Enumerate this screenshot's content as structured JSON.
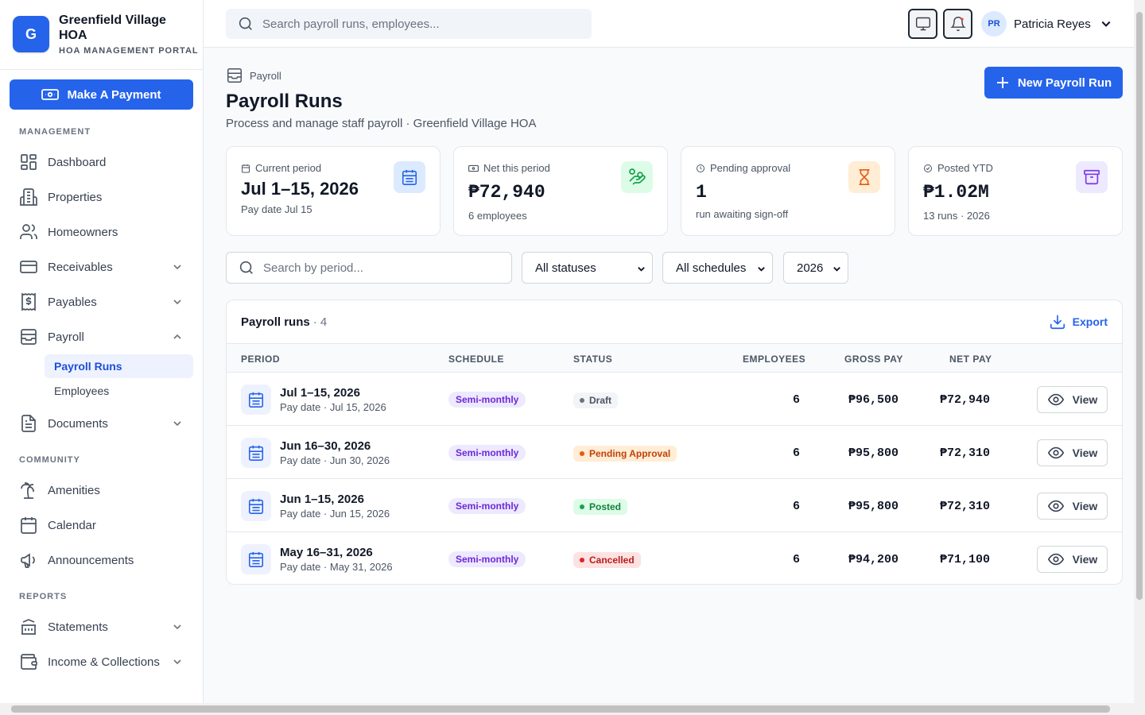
{
  "brand": {
    "logo_letter": "G",
    "name": "Greenfield Village HOA",
    "subtitle": "HOA MANAGEMENT PORTAL"
  },
  "sidebar": {
    "pay_button": "Make A Payment",
    "sections": {
      "management": "MANAGEMENT",
      "community": "COMMUNITY",
      "reports": "REPORTS"
    },
    "items": {
      "dashboard": "Dashboard",
      "properties": "Properties",
      "homeowners": "Homeowners",
      "receivables": "Receivables",
      "payables": "Payables",
      "payroll": "Payroll",
      "payroll_runs": "Payroll Runs",
      "employees": "Employees",
      "documents": "Documents",
      "amenities": "Amenities",
      "calendar": "Calendar",
      "announcements": "Announcements",
      "statements": "Statements",
      "income_collections": "Income & Collections"
    }
  },
  "topbar": {
    "search_placeholder": "Search payroll runs, employees...",
    "user": {
      "initials": "PR",
      "name": "Patricia Reyes"
    }
  },
  "page": {
    "breadcrumb": "Payroll",
    "title": "Payroll Runs",
    "subtitle": "Process and manage staff payroll · Greenfield Village HOA",
    "new_button": "New Payroll Run"
  },
  "cards": {
    "current": {
      "label": "Current period",
      "value": "Jul 1–15, 2026",
      "foot": "Pay date Jul 15"
    },
    "net": {
      "label": "Net this period",
      "value": "₱72,940",
      "foot": "6 employees"
    },
    "pending": {
      "label": "Pending approval",
      "value": "1",
      "foot": "run awaiting sign-off"
    },
    "posted": {
      "label": "Posted YTD",
      "value": "₱1.02M",
      "foot": "13 runs · 2026"
    }
  },
  "filters": {
    "search_placeholder": "Search by period...",
    "status": "All statuses",
    "schedule": "All schedules",
    "year": "2026"
  },
  "table": {
    "title": "Payroll runs",
    "count": "· 4",
    "export": "Export",
    "columns": {
      "period": "PERIOD",
      "schedule": "SCHEDULE",
      "status": "STATUS",
      "employees": "EMPLOYEES",
      "gross": "GROSS PAY",
      "net": "NET PAY"
    },
    "view_label": "View",
    "rows": [
      {
        "period": "Jul 1–15, 2026",
        "pay_date": "Pay date · Jul 15, 2026",
        "schedule": "Semi-monthly",
        "status": "Draft",
        "employees": "6",
        "gross": "₱96,500",
        "net": "₱72,940"
      },
      {
        "period": "Jun 16–30, 2026",
        "pay_date": "Pay date · Jun 30, 2026",
        "schedule": "Semi-monthly",
        "status": "Pending Approval",
        "employees": "6",
        "gross": "₱95,800",
        "net": "₱72,310"
      },
      {
        "period": "Jun 1–15, 2026",
        "pay_date": "Pay date · Jun 15, 2026",
        "schedule": "Semi-monthly",
        "status": "Posted",
        "employees": "6",
        "gross": "₱95,800",
        "net": "₱72,310"
      },
      {
        "period": "May 16–31, 2026",
        "pay_date": "Pay date · May 31, 2026",
        "schedule": "Semi-monthly",
        "status": "Cancelled",
        "employees": "6",
        "gross": "₱94,200",
        "net": "₱71,100"
      }
    ]
  },
  "colors": {
    "accent": "#2563eb",
    "draft": "#6b7280",
    "pending": "#ea580c",
    "posted": "#16a34a",
    "cancelled": "#dc2626"
  }
}
